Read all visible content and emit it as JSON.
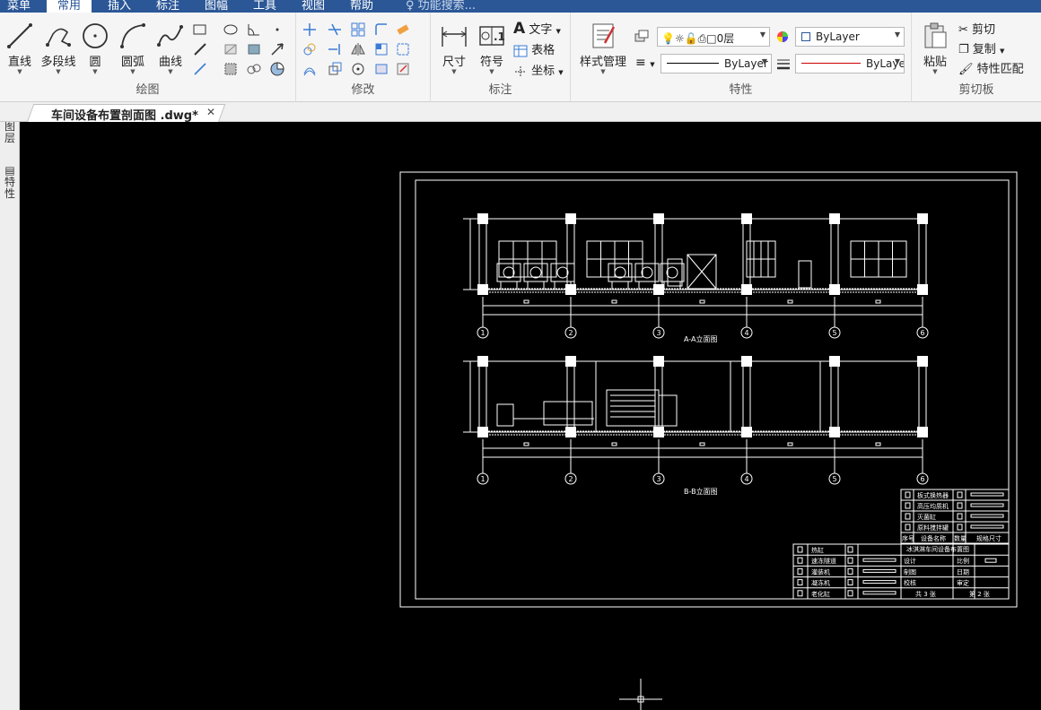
{
  "menu": {
    "items": [
      "菜单",
      "常用",
      "插入",
      "标注",
      "图幅",
      "工具",
      "视图",
      "帮助"
    ],
    "active": "常用",
    "search_placeholder": "功能搜索..."
  },
  "ribbon": {
    "draw": {
      "label": "绘图",
      "tools": [
        "直线",
        "多段线",
        "圆",
        "圆弧",
        "曲线"
      ]
    },
    "modify": {
      "label": "修改"
    },
    "annotate": {
      "label": "标注",
      "dimension": "尺寸",
      "symbol": "符号",
      "text": "文字",
      "table": "表格",
      "coordinate": "坐标"
    },
    "properties": {
      "label": "特性",
      "style_manager": "样式管理",
      "layer_value": "0层",
      "color_value": "ByLayer",
      "linetype_value": "ByLayer",
      "lineweight_value": "ByLaye"
    },
    "clipboard": {
      "label": "剪切板",
      "paste": "粘贴",
      "cut": "剪切",
      "copy": "复制",
      "match_props": "特性匹配"
    }
  },
  "document": {
    "tab_title": "车间设备布置剖面图 .dwg*"
  },
  "sidepanel": {
    "layers": "图层",
    "properties": "特性"
  },
  "drawing": {
    "section_aa": "A-A立面图",
    "section_bb": "B-B立面图",
    "axis_labels": [
      "1",
      "2",
      "3",
      "4",
      "5",
      "6"
    ],
    "equipment_table": {
      "rows": [
        "板式换热器",
        "高压均质机",
        "灭菌缸",
        "原料搅拌罐"
      ],
      "header": [
        "序号",
        "设备名称",
        "数量",
        "规格尺寸"
      ]
    },
    "title_block": {
      "title": "冰淇淋车间设备布置图",
      "rows": [
        "热缸",
        "速冻隧道",
        "灌装机",
        "凝冻机",
        "老化缸"
      ],
      "fields": [
        "设计",
        "制图",
        "校核",
        "比例",
        "日期",
        "审定"
      ],
      "sheet_total": "共 3 张",
      "sheet_number": "第 2 张"
    }
  }
}
